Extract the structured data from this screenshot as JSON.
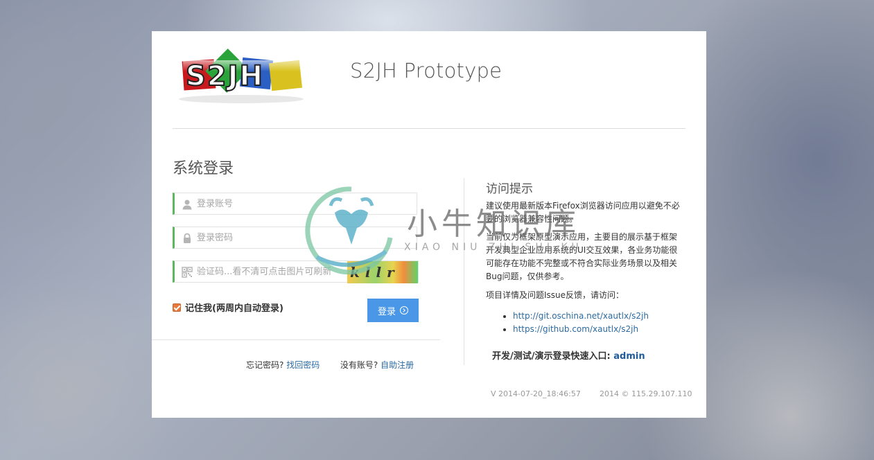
{
  "header": {
    "logo_text": "S2JH",
    "title": "S2JH Prototype"
  },
  "login": {
    "title": "系统登录",
    "username_placeholder": "登录账号",
    "password_placeholder": "登录密码",
    "captcha_placeholder": "验证码...看不清可点击图片可刷新",
    "captcha_text": "kllr",
    "remember_label": "记住我(两周内自动登录)",
    "remember_checked": true,
    "submit_label": "登录",
    "forgot_text": "忘记密码?",
    "forgot_link": "找回密码",
    "no_account_text": "没有账号?",
    "register_link": "自助注册"
  },
  "tips": {
    "title": "访问提示",
    "p1": "建议使用最新版本Firefox浏览器访问应用以避免不必要的浏览器兼容性问题。",
    "p2": "当前仅为框架原型演示应用，主要目的展示基于框架开发典型企业应用系统的UI交互效果，各业务功能很可能存在功能不完整或不符合实际业务场景以及相关Bug问题，仅供参考。",
    "p3": "项目详情及问题Issue反馈，请访问：",
    "links": [
      "http://git.oschina.net/xautlx/s2jh",
      "https://github.com/xautlx/s2jh"
    ],
    "quick_entry_label": "开发/测试/演示登录快速入口:",
    "quick_entry_user": "admin"
  },
  "footer": {
    "version": "V 2014-07-20_18:46:57",
    "copyright": "2014 © 115.29.107.110"
  },
  "watermark": {
    "text": "小牛知识库",
    "sub": "XIAO NIU ZHI SHI KU"
  },
  "colors": {
    "accent": "#5cb85c",
    "button": "#4a97e8",
    "link": "#2a6aa0"
  }
}
